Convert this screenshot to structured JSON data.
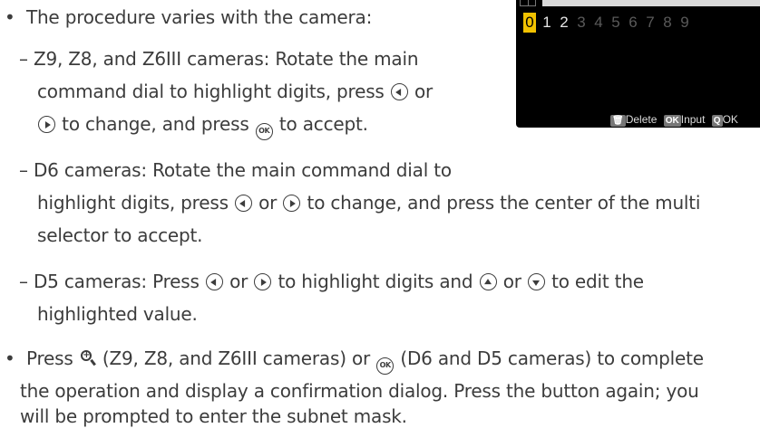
{
  "bullets": {
    "b1_intro": "The procedure varies with the camera:",
    "z_line1": "– Z9, Z8, and Z6III cameras: Rotate the main",
    "z_line2_a": "command dial to highlight digits, press",
    "z_line2_b": "or",
    "z_line3": "to change, and press",
    "z_line3_end": "to accept.",
    "d6_line1": "– D6 cameras: Rotate the main command dial to",
    "d6_line2_a": "highlight digits, press",
    "d6_line2_b": "or",
    "d6_line2_c": "to change, and press the center of the multi",
    "d6_line3": "selector to accept.",
    "d5_line1_a": "– D5 cameras: Press",
    "d5_line1_b": "or",
    "d5_line1_c": "to highlight digits and",
    "d5_line1_d": "or",
    "d5_line1_e": "to edit the",
    "d5_line2": "highlighted value.",
    "b2_line1_a": "Press",
    "b2_line1_b": "(Z9, Z8, and Z6III cameras) or",
    "b2_line1_c": "(D6 and D5 cameras) to complete",
    "b2_line2": "the operation and display a confirmation dialog. Press the button again; you",
    "b2_line3": "will be prompted to enter the subnet mask.",
    "bullet_char": "•",
    "ok_icon_text": "OK"
  },
  "camera_screen": {
    "digits": [
      "0",
      "1",
      "2",
      "3",
      "4",
      "5",
      "6",
      "7",
      "8",
      "9"
    ],
    "selected_digit": "0",
    "footer": {
      "delete_label": "Delete",
      "input_badge": "OK",
      "input_label": "Input",
      "confirm_label": "OK"
    }
  },
  "colors": {
    "text": "#3c3c3c",
    "highlight": "#f2c200",
    "screen_bg": "#000000"
  },
  "icons": [
    "multi-selector-left-icon",
    "multi-selector-right-icon",
    "multi-selector-up-icon",
    "multi-selector-down-icon",
    "ok-button-icon",
    "zoom-in-button-icon",
    "trash-icon"
  ]
}
